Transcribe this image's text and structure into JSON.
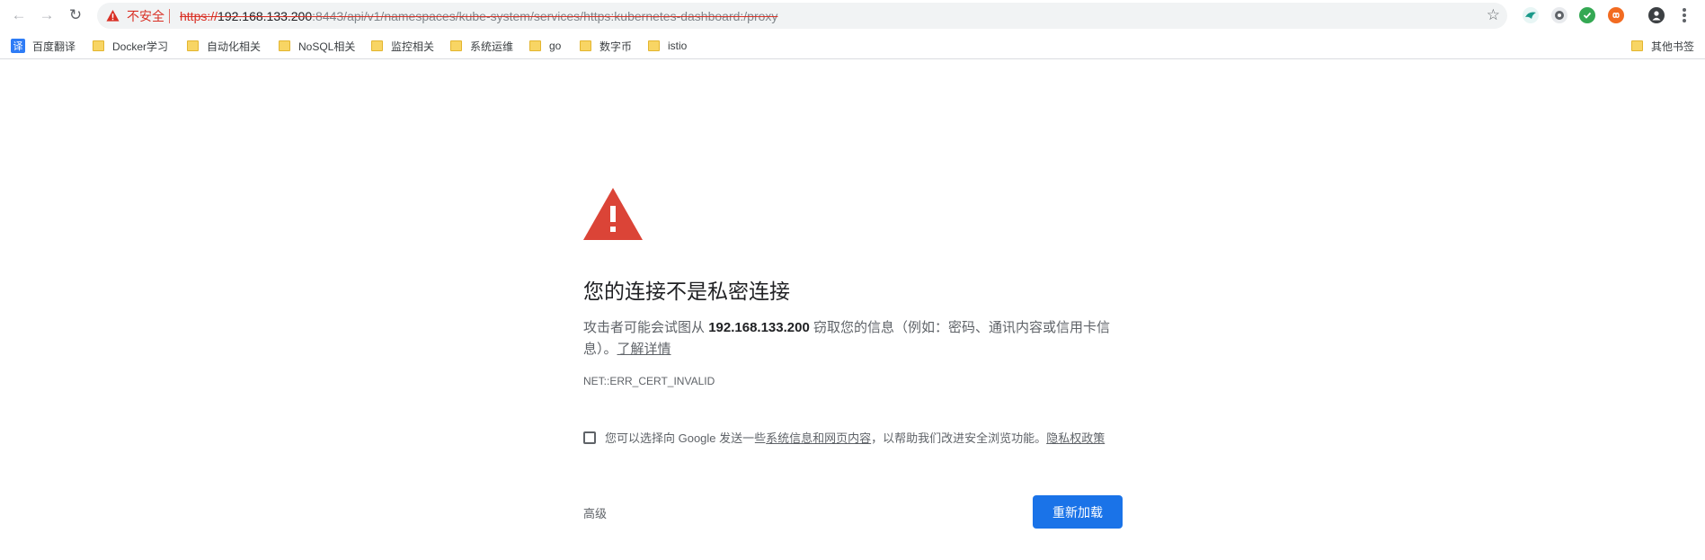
{
  "browser": {
    "back_label": "←",
    "forward_label": "→",
    "reload_label": "↻",
    "security_label": "不安全",
    "url": {
      "scheme": "https://",
      "host": "192.168.133.200",
      "path": ":8443/api/v1/namespaces/kube-system/services/https:kubernetes-dashboard:/proxy"
    },
    "bookmark_star": "☆",
    "extensions": [
      "extension-icon",
      "extension-icon",
      "shield-check-icon",
      "extension-icon",
      "profile-avatar-icon"
    ]
  },
  "bookmarks": {
    "items": [
      {
        "label": "百度翻译",
        "icon": "translate-icon"
      },
      {
        "label": "Docker学习",
        "icon": "folder-icon"
      },
      {
        "label": "自动化相关",
        "icon": "folder-icon"
      },
      {
        "label": "NoSQL相关",
        "icon": "folder-icon"
      },
      {
        "label": "监控相关",
        "icon": "folder-icon"
      },
      {
        "label": "系统运维",
        "icon": "folder-icon"
      },
      {
        "label": "go",
        "icon": "folder-icon"
      },
      {
        "label": "数字币",
        "icon": "folder-icon"
      },
      {
        "label": "istio",
        "icon": "folder-icon"
      }
    ],
    "other_label": "其他书签",
    "translate_glyph": "译"
  },
  "interstitial": {
    "heading": "您的连接不是私密连接",
    "explanation_prefix": "攻击者可能会试图从",
    "host": "192.168.133.200",
    "explanation_suffix": "窃取您的信息（例如：密码、通讯内容或信用卡信息）。",
    "learn_more": "了解详情",
    "error_code": "NET::ERR_CERT_INVALID",
    "optin_prefix": "您可以选择向 Google 发送一些",
    "optin_link": "系统信息和网页内容",
    "optin_middle": "，以帮助我们改进安全浏览功能。",
    "privacy_link": "隐私权政策",
    "advanced_label": "高级",
    "reload_button": "重新加载"
  },
  "colors": {
    "danger": "#d93025",
    "primary": "#1a73e8",
    "alert_icon": "#db4437"
  }
}
